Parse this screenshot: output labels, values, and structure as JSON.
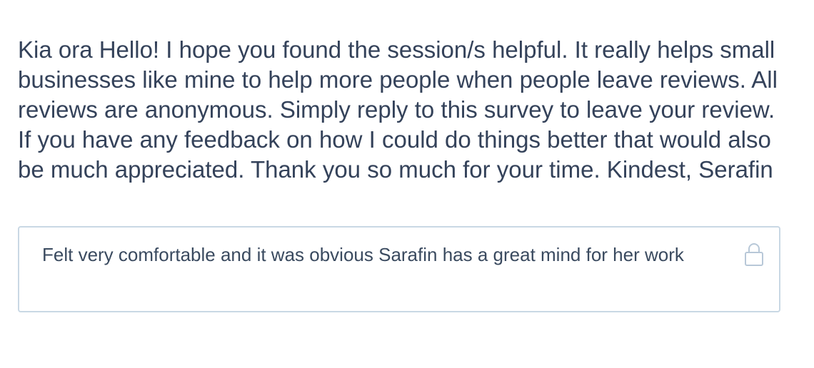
{
  "survey": {
    "question": "Kia ora Hello! I hope you found the session/s helpful. It really helps small businesses like mine to help more people when people leave reviews. All reviews are anonymous. Simply reply to this survey to leave your review. If you have any feedback on how I could do things better that would also be much appreciated. Thank you so much for your time. Kindest, Serafin",
    "answer": "Felt very comfortable and it was obvious Sarafin has a great mind for her work",
    "answer_locked_icon": "lock-icon"
  },
  "colors": {
    "text": "#34425a",
    "border": "#c9d8e4",
    "icon": "#b8c8d8"
  }
}
